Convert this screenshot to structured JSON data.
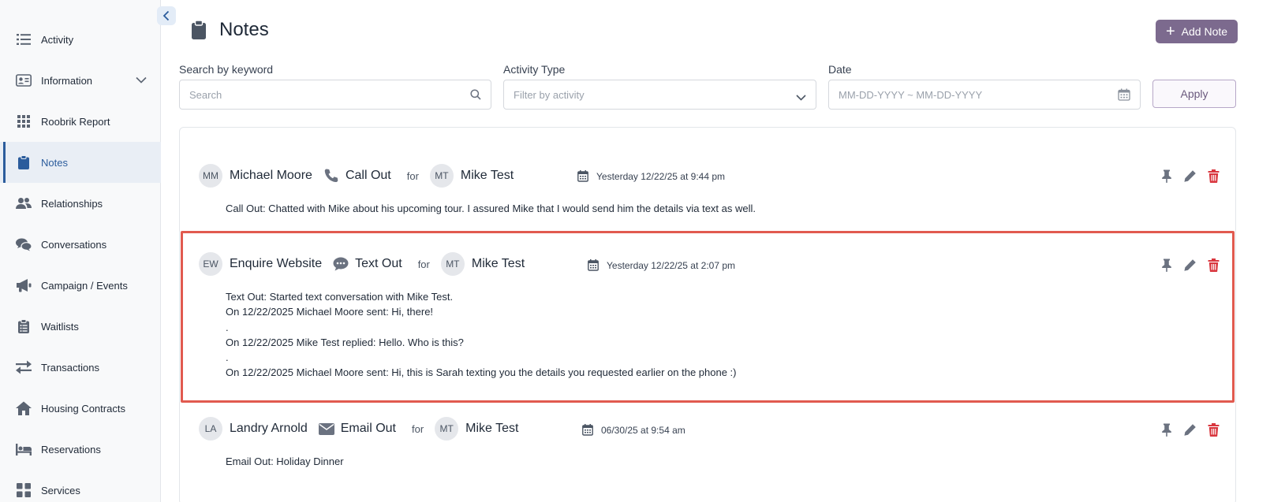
{
  "sidebar": {
    "items": [
      {
        "label": "Activity",
        "icon": "list-icon"
      },
      {
        "label": "Information",
        "icon": "id-card-icon"
      },
      {
        "label": "Roobrik Report",
        "icon": "grid-icon"
      },
      {
        "label": "Notes",
        "icon": "clipboard-icon"
      },
      {
        "label": "Relationships",
        "icon": "people-icon"
      },
      {
        "label": "Conversations",
        "icon": "chat-icon"
      },
      {
        "label": "Campaign / Events",
        "icon": "megaphone-icon"
      },
      {
        "label": "Waitlists",
        "icon": "clipboard-list-icon"
      },
      {
        "label": "Transactions",
        "icon": "swap-icon"
      },
      {
        "label": "Housing Contracts",
        "icon": "home-icon"
      },
      {
        "label": "Reservations",
        "icon": "bed-icon"
      },
      {
        "label": "Services",
        "icon": "apps-icon"
      }
    ]
  },
  "header": {
    "title": "Notes",
    "add_label": "Add Note"
  },
  "filters": {
    "keyword_label": "Search by keyword",
    "keyword_placeholder": "Search",
    "activity_label": "Activity Type",
    "activity_placeholder": "Filter by activity",
    "date_label": "Date",
    "date_placeholder": "MM-DD-YYYY ~ MM-DD-YYYY",
    "apply_label": "Apply"
  },
  "notes": [
    {
      "initials": "MM",
      "author": "Michael Moore",
      "activity": "Call Out",
      "activity_icon": "phone-icon",
      "for": "for",
      "target_initials": "MT",
      "target": "Mike Test",
      "date": "Yesterday 12/22/25 at 9:44 pm",
      "lines": [
        "Call Out: Chatted with Mike about his upcoming tour. I assured Mike that I would send him the details via text as well."
      ]
    },
    {
      "initials": "EW",
      "author": "Enquire Website",
      "activity": "Text Out",
      "activity_icon": "chat-bubble-icon",
      "for": "for",
      "target_initials": "MT",
      "target": "Mike Test",
      "date": "Yesterday 12/22/25 at 2:07 pm",
      "lines": [
        "Text Out: Started text conversation with Mike Test.",
        "On 12/22/2025 Michael Moore sent: Hi, there!",
        ".",
        "On 12/22/2025 Mike Test replied: Hello. Who is this?",
        ".",
        "On 12/22/2025 Michael Moore sent: Hi, this is Sarah texting you the details you requested earlier on the phone :)"
      ]
    },
    {
      "initials": "LA",
      "author": "Landry Arnold",
      "activity": "Email Out",
      "activity_icon": "envelope-icon",
      "for": "for",
      "target_initials": "MT",
      "target": "Mike Test",
      "date": "06/30/25 at 9:54 am",
      "lines": [
        "Email Out: Holiday Dinner"
      ]
    }
  ],
  "colors": {
    "accent": "#2b5c9c",
    "add_button": "#7c6a8e",
    "delete": "#d9363e",
    "highlight": "#e15a4f"
  }
}
